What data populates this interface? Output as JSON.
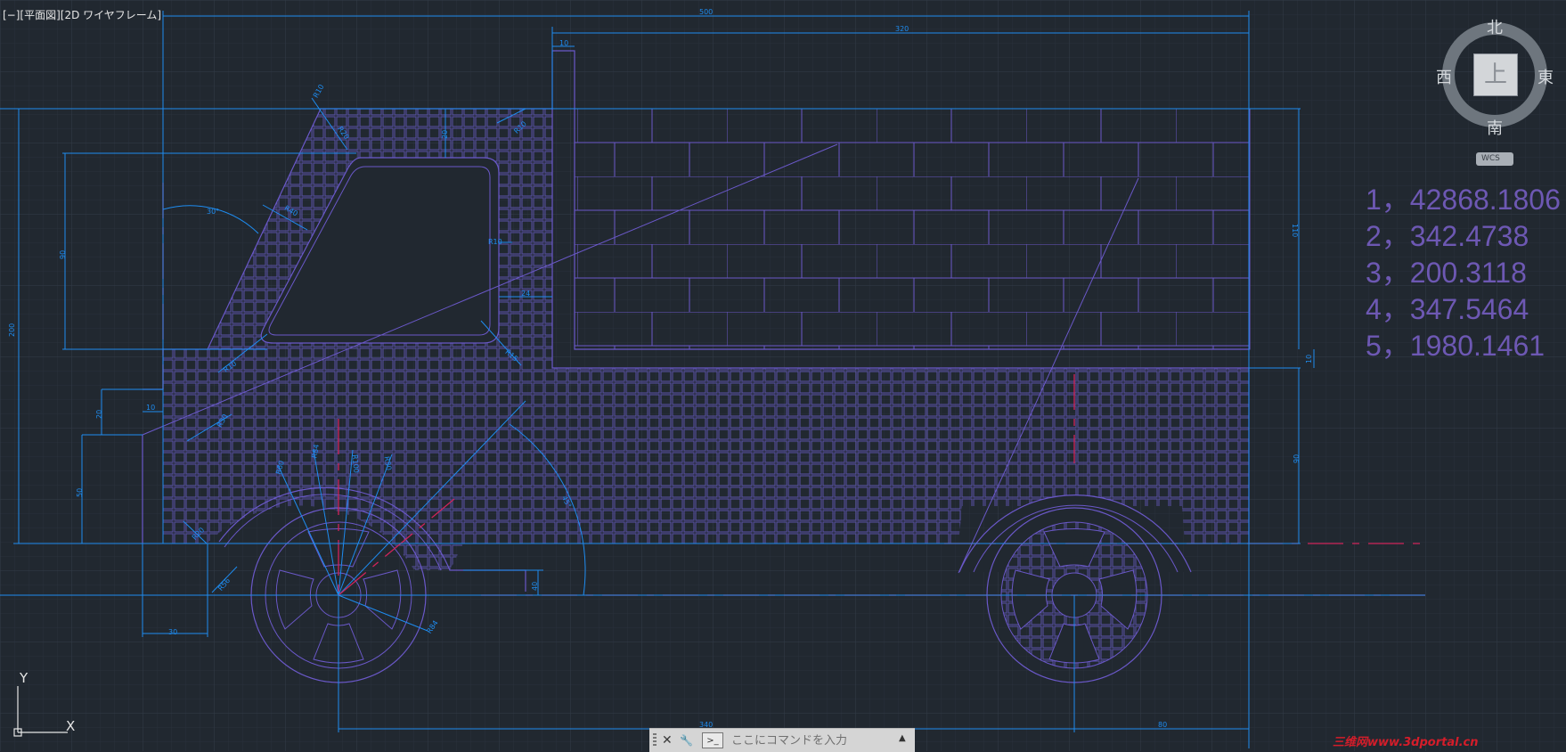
{
  "viewport": {
    "label": "[−][平面図][2D ワイヤフレーム]"
  },
  "viewcube": {
    "north": "北",
    "south": "南",
    "west": "西",
    "east": "東",
    "top_face": "上",
    "wcs_label": "WCS"
  },
  "readouts": [
    "1，42868.1806",
    "2，342.4738",
    "3，200.3118",
    "4，347.5464",
    "5，1980.1461"
  ],
  "dimensions": {
    "overall_width": "500",
    "cargo_width": "320",
    "post_width": "10",
    "cab_top_rise": "20",
    "cab_window_height": "90",
    "total_height": "200",
    "cargo_height": "110",
    "floor_offset": "10",
    "body_height": "90",
    "hood_height": "50",
    "bumper_rise": "20",
    "bumper_step": "10",
    "front_overhang": "30",
    "wheelbase": "340",
    "rear_overhang": "80",
    "window_gap": "24",
    "ground_clearance": "40",
    "windshield_angle": "30°",
    "wheel_arch_angle": "45°",
    "radius_r10": "R10",
    "radius_r20": "R20",
    "radius_r30": "R30",
    "radius_r40": "R40",
    "radius_r56": "R56",
    "radius_r60": "R60",
    "radius_r84": "R84",
    "radius_r100": "R100",
    "radius_r15": "R15"
  },
  "ucs": {
    "y_label": "Y",
    "x_label": "X"
  },
  "command_line": {
    "placeholder": "ここにコマンドを入力",
    "close_glyph": "✕",
    "customize_glyph": "🔧",
    "prompt_glyph": ">_",
    "history_glyph": "▲"
  },
  "watermark": "三维网www.3dportal.cn",
  "colors": {
    "background": "#212830",
    "grid": "#2c343f",
    "grid_major": "#333c48",
    "drawing": "#6a58c8",
    "dimension": "#1e8cf0",
    "centerline": "#d0245a",
    "hatch": "#5b52a8"
  }
}
